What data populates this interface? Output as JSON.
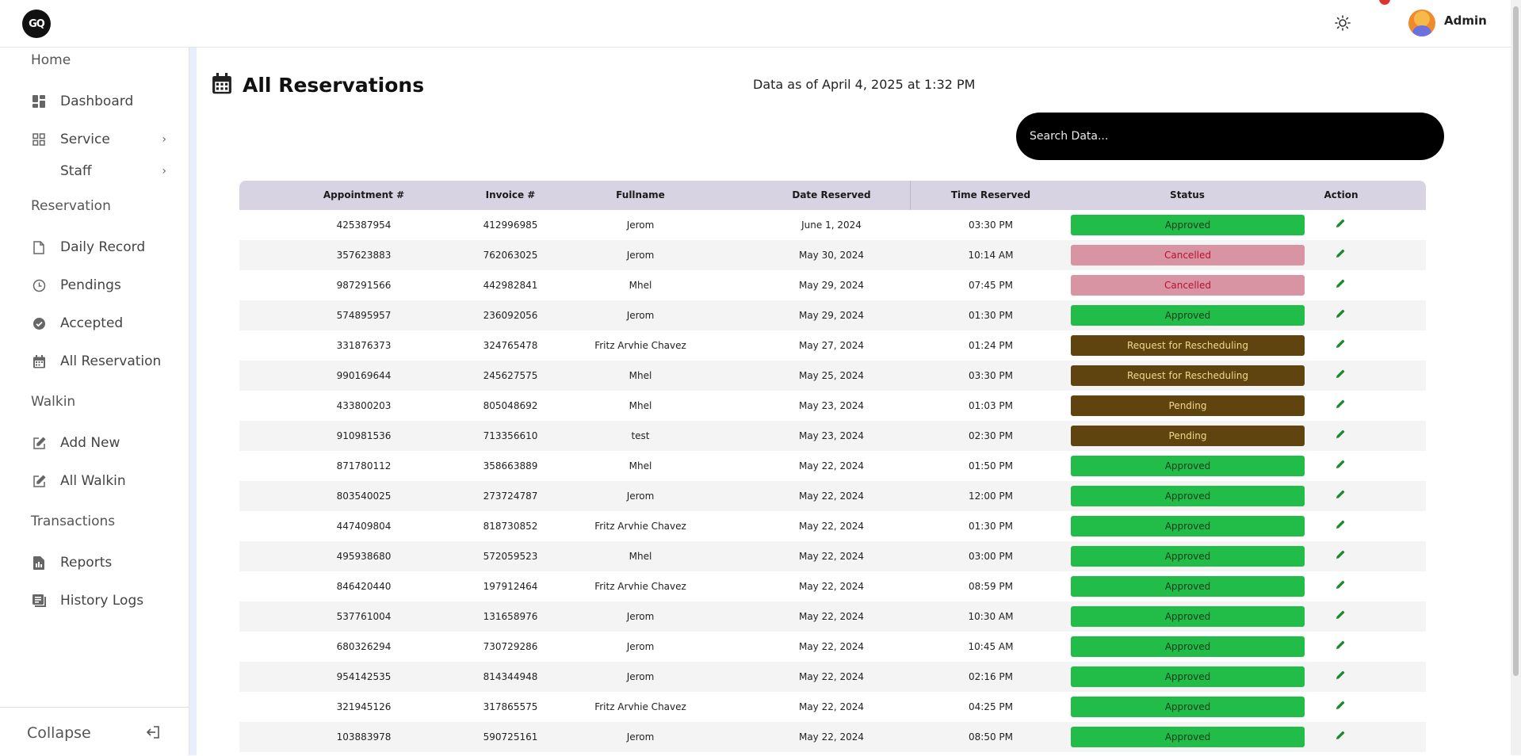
{
  "header": {
    "logo_text": "GQ",
    "user_name": "Admin"
  },
  "sidebar": {
    "sections": {
      "home": "Home",
      "reservation": "Reservation",
      "walkin": "Walkin",
      "transactions": "Transactions"
    },
    "items": {
      "dashboard": "Dashboard",
      "service": "Service",
      "staff": "Staff",
      "daily_record": "Daily Record",
      "pendings": "Pendings",
      "accepted": "Accepted",
      "all_reservation": "All Reservation",
      "add_new": "Add New",
      "all_walkin": "All Walkin",
      "reports": "Reports",
      "history_logs": "History Logs"
    },
    "chevron": "›",
    "collapse_label": "Collapse"
  },
  "main": {
    "title": "All Reservations",
    "data_as_of": "Data as of April 4, 2025 at 1:32 PM",
    "search_placeholder": "Search Data..."
  },
  "table": {
    "columns": [
      "Appointment #",
      "Invoice #",
      "Fullname",
      "Date Reserved",
      "Time Reserved",
      "Status",
      "Action"
    ],
    "rows": [
      {
        "appointment": "425387954",
        "invoice": "412996985",
        "fullname": "Jerom",
        "date": "June 1, 2024",
        "time": "03:30 PM",
        "status": "Approved"
      },
      {
        "appointment": "357623883",
        "invoice": "762063025",
        "fullname": "Jerom",
        "date": "May 30, 2024",
        "time": "10:14 AM",
        "status": "Cancelled"
      },
      {
        "appointment": "987291566",
        "invoice": "442982841",
        "fullname": "Mhel",
        "date": "May 29, 2024",
        "time": "07:45 PM",
        "status": "Cancelled"
      },
      {
        "appointment": "574895957",
        "invoice": "236092056",
        "fullname": "Jerom",
        "date": "May 29, 2024",
        "time": "01:30 PM",
        "status": "Approved"
      },
      {
        "appointment": "331876373",
        "invoice": "324765478",
        "fullname": "Fritz Arvhie Chavez",
        "date": "May 27, 2024",
        "time": "01:24 PM",
        "status": "Request for Rescheduling"
      },
      {
        "appointment": "990169644",
        "invoice": "245627575",
        "fullname": "Mhel",
        "date": "May 25, 2024",
        "time": "03:30 PM",
        "status": "Request for Rescheduling"
      },
      {
        "appointment": "433800203",
        "invoice": "805048692",
        "fullname": "Mhel",
        "date": "May 23, 2024",
        "time": "01:03 PM",
        "status": "Pending"
      },
      {
        "appointment": "910981536",
        "invoice": "713356610",
        "fullname": "test",
        "date": "May 23, 2024",
        "time": "02:30 PM",
        "status": "Pending"
      },
      {
        "appointment": "871780112",
        "invoice": "358663889",
        "fullname": "Mhel",
        "date": "May 22, 2024",
        "time": "01:50 PM",
        "status": "Approved"
      },
      {
        "appointment": "803540025",
        "invoice": "273724787",
        "fullname": "Jerom",
        "date": "May 22, 2024",
        "time": "12:00 PM",
        "status": "Approved"
      },
      {
        "appointment": "447409804",
        "invoice": "818730852",
        "fullname": "Fritz Arvhie Chavez",
        "date": "May 22, 2024",
        "time": "01:30 PM",
        "status": "Approved"
      },
      {
        "appointment": "495938680",
        "invoice": "572059523",
        "fullname": "Mhel",
        "date": "May 22, 2024",
        "time": "03:00 PM",
        "status": "Approved"
      },
      {
        "appointment": "846420440",
        "invoice": "197912464",
        "fullname": "Fritz Arvhie Chavez",
        "date": "May 22, 2024",
        "time": "08:59 PM",
        "status": "Approved"
      },
      {
        "appointment": "537761004",
        "invoice": "131658976",
        "fullname": "Jerom",
        "date": "May 22, 2024",
        "time": "10:30 AM",
        "status": "Approved"
      },
      {
        "appointment": "680326294",
        "invoice": "730729286",
        "fullname": "Jerom",
        "date": "May 22, 2024",
        "time": "10:45 AM",
        "status": "Approved"
      },
      {
        "appointment": "954142535",
        "invoice": "814344948",
        "fullname": "Jerom",
        "date": "May 22, 2024",
        "time": "02:16 PM",
        "status": "Approved"
      },
      {
        "appointment": "321945126",
        "invoice": "317865575",
        "fullname": "Fritz Arvhie Chavez",
        "date": "May 22, 2024",
        "time": "04:25 PM",
        "status": "Approved"
      },
      {
        "appointment": "103883978",
        "invoice": "590725161",
        "fullname": "Jerom",
        "date": "May 22, 2024",
        "time": "08:50 PM",
        "status": "Approved"
      }
    ]
  },
  "colors": {
    "approved": "#21bd48",
    "cancelled": "#d994a4",
    "rescheduling": "#5f4410",
    "pending": "#5f4410",
    "edit_icon": "#1b8a2e",
    "table_header": "#d7d3e2"
  },
  "icons": {
    "logo": "gq-logo-icon",
    "theme": "sun-icon",
    "dashboard": "grid-squares-icon",
    "service": "grid-outline-icon",
    "daily_record": "document-icon",
    "pendings": "clock-icon",
    "accepted": "check-badge-icon",
    "all_reservation": "calendar-icon",
    "add_new": "edit-square-icon",
    "all_walkin": "edit-square-icon",
    "reports": "report-file-icon",
    "history_logs": "list-icon",
    "collapse": "logout-arrow-icon",
    "edit": "pencil-icon"
  }
}
